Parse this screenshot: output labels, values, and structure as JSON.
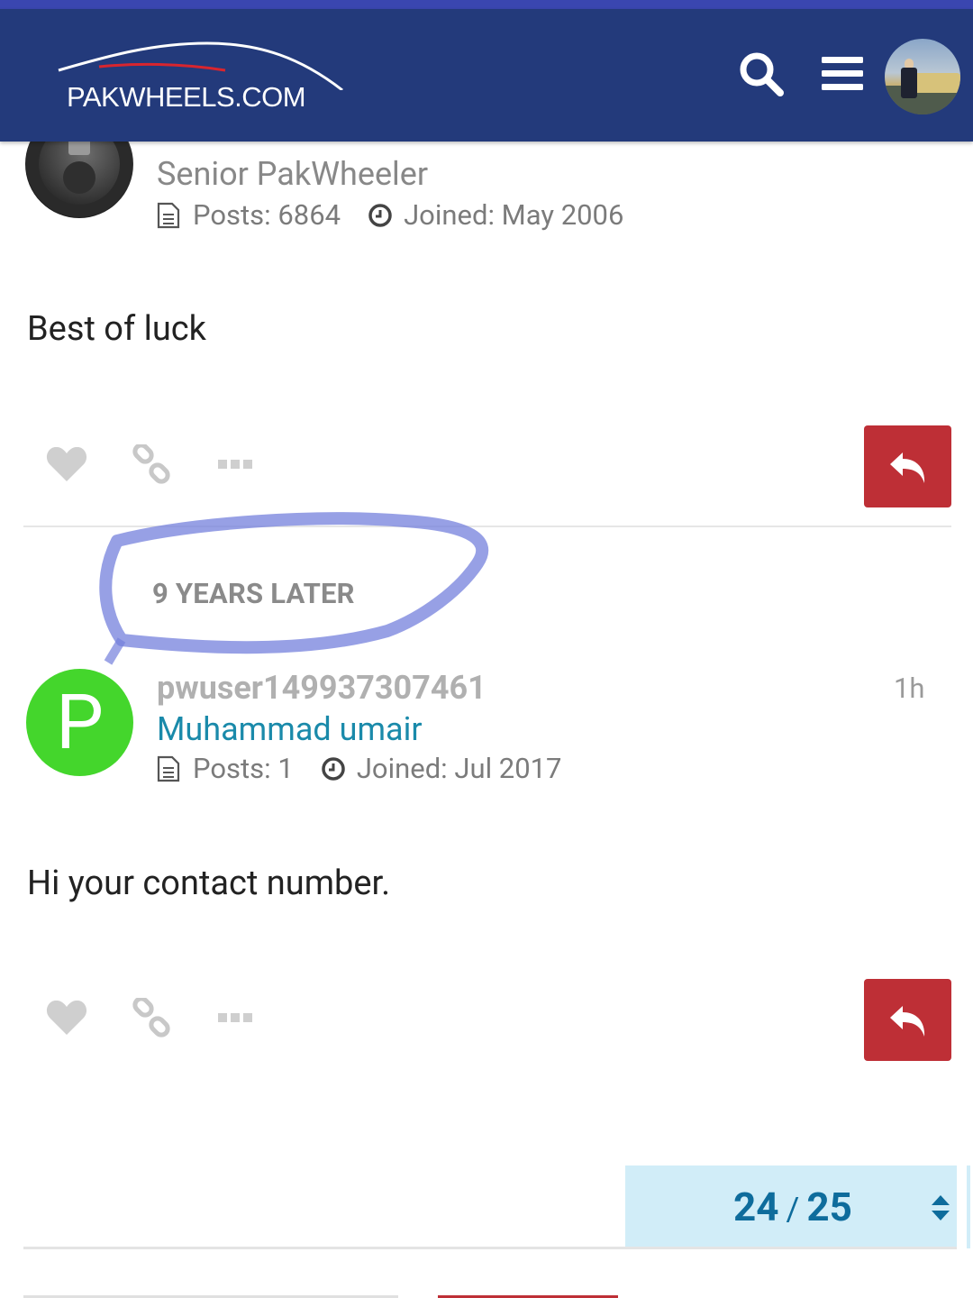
{
  "header": {
    "logo_text": "PAKWHEELS.COM",
    "brand_color": "#233a7b",
    "icons": [
      "search-icon",
      "hamburger-menu-icon",
      "user-avatar"
    ]
  },
  "posts": [
    {
      "title": "Senior PakWheeler",
      "posts_label": "Posts: 6864",
      "joined_label": "Joined: May 2006",
      "body": "Best of luck"
    },
    {
      "username": "pwuser149937307461",
      "full_name": "Muhammad umair",
      "avatar_letter": "P",
      "avatar_color": "#44d62c",
      "time": "1h",
      "posts_label": "Posts: 1",
      "joined_label": "Joined: Jul 2017",
      "body": "Hi your contact number."
    }
  ],
  "gap_notice": "9 YEARS LATER",
  "progress": {
    "current": "24",
    "separator": "/",
    "total": "25"
  },
  "colors": {
    "reply_button": "#be2f36",
    "progress_bg": "#d1edf8",
    "accent_text": "#1a8aaa"
  }
}
